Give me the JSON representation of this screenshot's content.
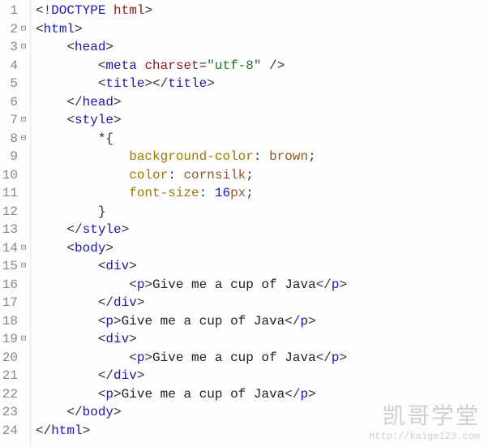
{
  "watermark": {
    "main": "凯哥学堂",
    "sub": "http://kaige123.com"
  },
  "lines": [
    {
      "n": "1",
      "fold": "",
      "html": "<span class='punc'>&lt;!</span><span class='doctype'>DOCTYPE</span> <span class='attr'>html</span><span class='punc'>&gt;</span>"
    },
    {
      "n": "2",
      "fold": "⊟",
      "html": "<span class='punc'>&lt;</span><span class='tag'>html</span><span class='punc'>&gt;</span>"
    },
    {
      "n": "3",
      "fold": "⊟",
      "html": "    <span class='punc'>&lt;</span><span class='tag'>head</span><span class='punc'>&gt;</span>"
    },
    {
      "n": "4",
      "fold": "",
      "html": "        <span class='punc'>&lt;</span><span class='tag'>meta</span> <span class='attr'>charset</span><span class='punc'>=</span><span class='str'>\"utf-8\"</span> <span class='punc'>/&gt;</span>"
    },
    {
      "n": "5",
      "fold": "",
      "html": "        <span class='punc'>&lt;</span><span class='tag'>title</span><span class='punc'>&gt;&lt;/</span><span class='tag'>title</span><span class='punc'>&gt;</span>"
    },
    {
      "n": "6",
      "fold": "",
      "html": "    <span class='punc'>&lt;/</span><span class='tag'>head</span><span class='punc'>&gt;</span>"
    },
    {
      "n": "7",
      "fold": "⊟",
      "html": "    <span class='punc'>&lt;</span><span class='tag'>style</span><span class='punc'>&gt;</span>"
    },
    {
      "n": "8",
      "fold": "⊟",
      "html": "        <span class='text'>*</span><span class='punc'>{</span>"
    },
    {
      "n": "9",
      "fold": "",
      "html": "            <span class='prop'>background-color</span><span class='punc'>:</span> <span class='val'>brown</span><span class='punc'>;</span>"
    },
    {
      "n": "10",
      "fold": "",
      "html": "            <span class='prop'>color</span><span class='punc'>:</span> <span class='val'>cornsilk</span><span class='punc'>;</span>"
    },
    {
      "n": "11",
      "fold": "",
      "html": "            <span class='prop'>font-size</span><span class='punc'>:</span> <span class='num'>16</span><span class='val'>px</span><span class='punc'>;</span>"
    },
    {
      "n": "12",
      "fold": "",
      "html": "        <span class='punc'>}</span>"
    },
    {
      "n": "13",
      "fold": "",
      "html": "    <span class='punc'>&lt;/</span><span class='tag'>style</span><span class='punc'>&gt;</span>"
    },
    {
      "n": "14",
      "fold": "⊟",
      "html": "    <span class='punc'>&lt;</span><span class='tag'>body</span><span class='punc'>&gt;</span>"
    },
    {
      "n": "15",
      "fold": "⊟",
      "html": "        <span class='punc'>&lt;</span><span class='tag'>div</span><span class='punc'>&gt;</span>"
    },
    {
      "n": "16",
      "fold": "",
      "html": "            <span class='punc'>&lt;</span><span class='tag'>p</span><span class='punc'>&gt;</span><span class='text'>Give me a cup of Java</span><span class='punc'>&lt;/</span><span class='tag'>p</span><span class='punc'>&gt;</span>"
    },
    {
      "n": "17",
      "fold": "",
      "html": "        <span class='punc'>&lt;/</span><span class='tag'>div</span><span class='punc'>&gt;</span>"
    },
    {
      "n": "18",
      "fold": "",
      "html": "        <span class='punc'>&lt;</span><span class='tag'>p</span><span class='punc'>&gt;</span><span class='text'>Give me a cup of Java</span><span class='punc'>&lt;/</span><span class='tag'>p</span><span class='punc'>&gt;</span>"
    },
    {
      "n": "19",
      "fold": "⊟",
      "html": "        <span class='punc'>&lt;</span><span class='tag'>div</span><span class='punc'>&gt;</span>"
    },
    {
      "n": "20",
      "fold": "",
      "html": "            <span class='punc'>&lt;</span><span class='tag'>p</span><span class='punc'>&gt;</span><span class='text'>Give me a cup of Java</span><span class='punc'>&lt;/</span><span class='tag'>p</span><span class='punc'>&gt;</span>"
    },
    {
      "n": "21",
      "fold": "",
      "html": "        <span class='punc'>&lt;/</span><span class='tag'>div</span><span class='punc'>&gt;</span>"
    },
    {
      "n": "22",
      "fold": "",
      "html": "        <span class='punc'>&lt;</span><span class='tag'>p</span><span class='punc'>&gt;</span><span class='text'>Give me a cup of Java</span><span class='punc'>&lt;/</span><span class='tag'>p</span><span class='punc'>&gt;</span>"
    },
    {
      "n": "23",
      "fold": "",
      "html": "    <span class='punc'>&lt;/</span><span class='tag'>body</span><span class='punc'>&gt;</span>"
    },
    {
      "n": "24",
      "fold": "",
      "html": "<span class='punc'>&lt;/</span><span class='tag'>html</span><span class='punc'>&gt;</span>"
    }
  ]
}
